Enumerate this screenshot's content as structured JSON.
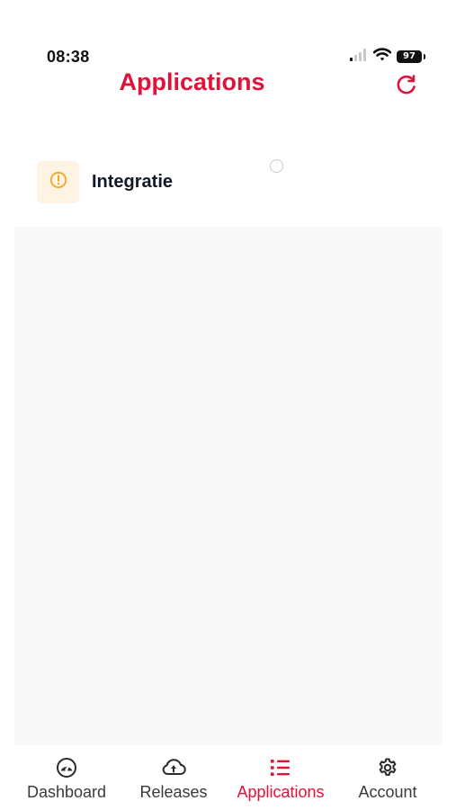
{
  "status_bar": {
    "time": "08:38",
    "battery": "97"
  },
  "header": {
    "title": "Applications",
    "refresh_icon": "refresh-icon"
  },
  "applications": [
    {
      "name": "Integratie",
      "status_icon": "warning-circle-icon",
      "status_color": "#f5a623"
    }
  ],
  "tab_bar": {
    "tabs": [
      {
        "label": "Dashboard",
        "icon": "gauge-icon",
        "active": false
      },
      {
        "label": "Releases",
        "icon": "cloud-upload-icon",
        "active": false
      },
      {
        "label": "Applications",
        "icon": "list-icon",
        "active": true
      },
      {
        "label": "Account",
        "icon": "gear-icon",
        "active": false
      }
    ]
  },
  "colors": {
    "accent": "#e0123a",
    "warning": "#f5a623",
    "content_background": "#f8f8f8"
  }
}
